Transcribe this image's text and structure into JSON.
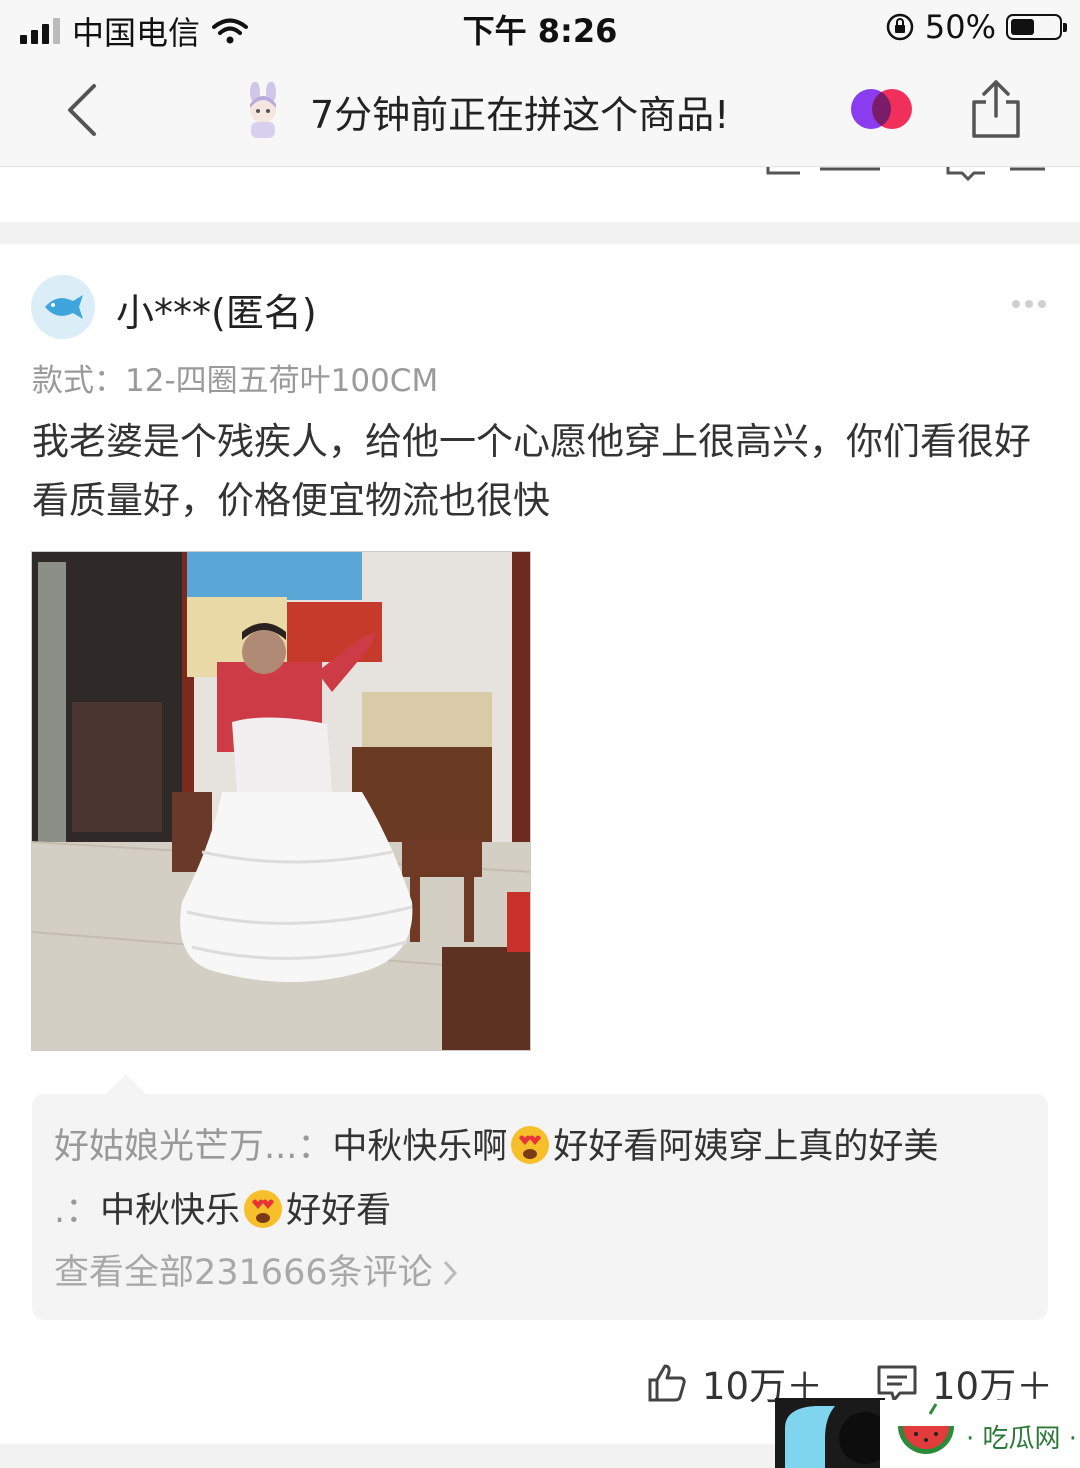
{
  "status_bar": {
    "carrier": "中国电信",
    "time": "下午 8:26",
    "battery": "50%",
    "battery_level": 0.5
  },
  "nav": {
    "title": "7分钟前正在拼这个商品!"
  },
  "review": {
    "user": "小***(匿名)",
    "spec": "款式：12-四圈五荷叶100CM",
    "text": "我老婆是个残疾人，给他一个心愿他穿上很高兴，你们看很好看质量好，价格便宜物流也很快"
  },
  "comments": [
    {
      "author": "好姑娘光芒万...：",
      "before": "中秋快乐啊",
      "emoji": "heart-eyes-emoji",
      "after": "好好看阿姨穿上真的好美"
    },
    {
      "author": ".：",
      "before": "中秋快乐",
      "emoji": "heart-eyes-emoji",
      "after": "好好看"
    }
  ],
  "view_all": "查看全部231666条评论",
  "actions": {
    "likes": "10万＋",
    "replies": "10万＋"
  },
  "watermark": {
    "text": "· 吃瓜网 ·"
  },
  "colors": {
    "pin_left": "#8a3cf0",
    "pin_right": "#f0305a",
    "watermelon": "#2c8a3a"
  }
}
